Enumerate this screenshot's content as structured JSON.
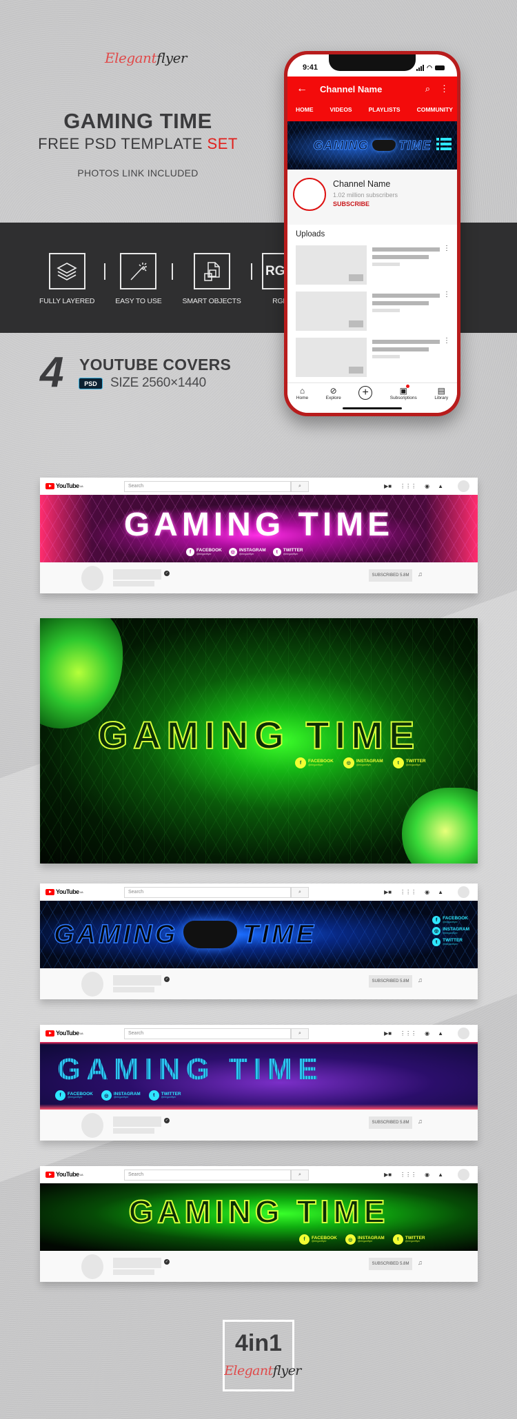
{
  "branding": {
    "logo_part1": "Elegant",
    "logo_part2": "flyer"
  },
  "header": {
    "title": "GAMING TIME",
    "subtitle_main": "FREE PSD TEMPLATE",
    "subtitle_accent": "SET",
    "note": "PHOTOS LINK INCLUDED",
    "accent_color": "#e0201c"
  },
  "features": [
    {
      "icon": "layers-icon",
      "label": "FULLY LAYERED"
    },
    {
      "icon": "magic-wand-icon",
      "label": "EASY TO USE"
    },
    {
      "icon": "smart-objects-icon",
      "label": "SMART OBJECTS"
    },
    {
      "icon": "rgb-icon",
      "icon_text": "RGB",
      "label": "RGB"
    }
  ],
  "covers_info": {
    "count": "4",
    "heading": "YOUTUBE COVERS",
    "format_badge": "PSD",
    "size": "SIZE 2560×1440"
  },
  "phone": {
    "time": "9:41",
    "back_icon": "←",
    "channel_title": "Channel Name",
    "tabs": [
      "HOME",
      "VIDEOS",
      "PLAYLISTS",
      "COMMUNITY"
    ],
    "banner_text_left": "GAMING",
    "banner_text_right": "TIME",
    "channel_name": "Channel Name",
    "subscribers": "1.02 million subscribers",
    "subscribe_label": "SUBSCRIBE",
    "uploads_heading": "Uploads",
    "uploads_count_visible": 3,
    "bottom_nav": [
      {
        "icon": "home-icon",
        "glyph": "⌂",
        "label": "Home"
      },
      {
        "icon": "explore-icon",
        "glyph": "⊘",
        "label": "Explore"
      },
      {
        "icon": "create-icon",
        "glyph": "+",
        "label": ""
      },
      {
        "icon": "subscriptions-icon",
        "glyph": "▣",
        "label": "Subscriptions"
      },
      {
        "icon": "library-icon",
        "glyph": "▤",
        "label": "Library"
      }
    ],
    "brand_color": "#f30b0b"
  },
  "desktop_mock": {
    "logo_text": "YouTube",
    "region": "UA",
    "search_placeholder": "Search",
    "search_icon": "🔍",
    "subscribed_label": "SUBSCRIBED",
    "subscriber_count": "5.8M",
    "verified_icon": "✓",
    "bell_icon": "🔔"
  },
  "covers": [
    {
      "theme": "pink",
      "title": "GAMING TIME",
      "socials": [
        {
          "name": "FACEBOOK",
          "handle": "@elegantflyer",
          "glyph": "f"
        },
        {
          "name": "INSTAGRAM",
          "handle": "@elegantflyer",
          "glyph": "◎"
        },
        {
          "name": "TWITTER",
          "handle": "@elegantflyer",
          "glyph": "t"
        }
      ]
    },
    {
      "theme": "green-large",
      "title": "GAMING TIME",
      "socials": [
        {
          "name": "FACEBOOK",
          "handle": "@elegantflyer",
          "glyph": "f"
        },
        {
          "name": "INSTAGRAM",
          "handle": "@elegantflyer",
          "glyph": "◎"
        },
        {
          "name": "TWITTER",
          "handle": "@elegantflyer",
          "glyph": "t"
        }
      ]
    },
    {
      "theme": "blue",
      "title_left": "GAMING",
      "title_right": "TIME",
      "socials": [
        {
          "name": "FACEBOOK",
          "handle": "@elegantflyer",
          "glyph": "f"
        },
        {
          "name": "INSTAGRAM",
          "handle": "@elegantflyer",
          "glyph": "◎"
        },
        {
          "name": "TWITTER",
          "handle": "@elegantflyer",
          "glyph": "t"
        }
      ]
    },
    {
      "theme": "purple",
      "title": "GAMING  TIME",
      "socials": [
        {
          "name": "FACEBOOK",
          "handle": "@elegantflyer",
          "glyph": "f"
        },
        {
          "name": "INSTAGRAM",
          "handle": "@elegantflyer",
          "glyph": "◎"
        },
        {
          "name": "TWITTER",
          "handle": "@elegantflyer",
          "glyph": "t"
        }
      ]
    },
    {
      "theme": "green",
      "title": "GAMING TIME",
      "socials": [
        {
          "name": "FACEBOOK",
          "handle": "@elegantflyer",
          "glyph": "f"
        },
        {
          "name": "INSTAGRAM",
          "handle": "@elegantflyer",
          "glyph": "◎"
        },
        {
          "name": "TWITTER",
          "handle": "@elegantflyer",
          "glyph": "t"
        }
      ]
    }
  ],
  "footer_badge": {
    "text": "4in1",
    "logo_part1": "Elegant",
    "logo_part2": "flyer"
  }
}
